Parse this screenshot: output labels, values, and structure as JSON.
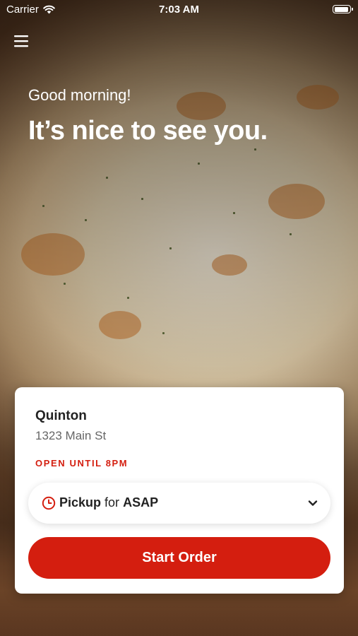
{
  "status_bar": {
    "carrier": "Carrier",
    "time": "7:03 AM"
  },
  "icons": {
    "menu": "hamburger-menu-icon",
    "wifi": "wifi-icon",
    "battery": "battery-icon",
    "clock": "clock-icon",
    "chevron": "chevron-down-icon"
  },
  "hero": {
    "greeting": "Good morning!",
    "headline": "It’s nice to see you."
  },
  "store": {
    "name": "Quinton",
    "address": "1323 Main St",
    "hours": "OPEN UNTIL 8PM"
  },
  "order_selector": {
    "mode": "Pickup",
    "connector": "for",
    "time": "ASAP"
  },
  "start_button": {
    "label": "Start Order"
  },
  "colors": {
    "accent": "#d41e0f",
    "card": "#ffffff",
    "text": "#222222",
    "muted": "#666666"
  }
}
